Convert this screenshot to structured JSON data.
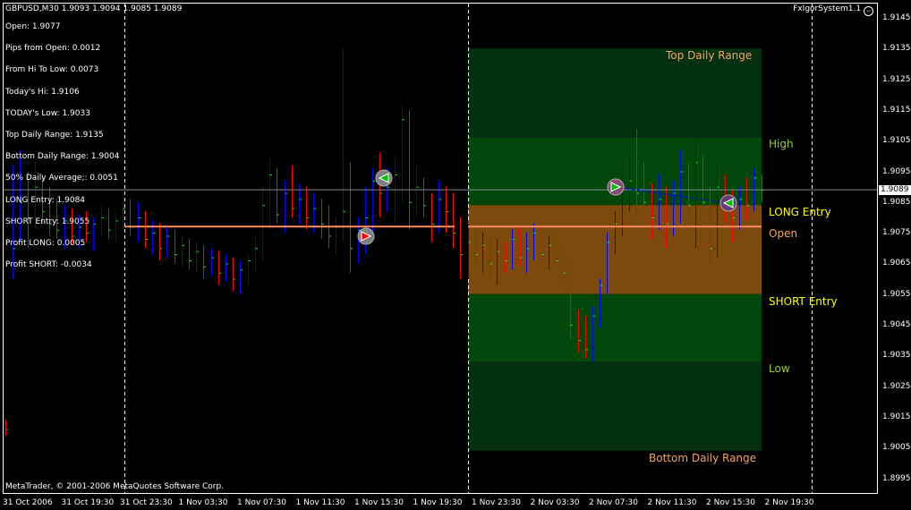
{
  "header": {
    "symbol_line": "GBPUSD,M30  1.9093 1.9094 1.9085 1.9089",
    "indicator_name": "FxIgorSystem1.1",
    "smiley_icon": "smiley-icon"
  },
  "info": [
    "Open: 1.9077",
    "Pips from Open: 0.0012",
    "From Hi To Low: 0.0073",
    "Today's Hi: 1.9106",
    "TODAY's Low: 1.9033",
    "Top Daily Range:  1.9135",
    "Bottom Daily Range: 1.9004",
    "50% Daily Average;: 0.0051",
    "LONG Entry:  1.9084",
    "SHORT Entry: 1.9055",
    "Profit LONG:  0.0005",
    "Profit SHORT: -0.0034"
  ],
  "copyright": "MetaTrader, © 2001-2006 MetaQuotes Software Corp.",
  "current_price": "1.9089",
  "zone_labels": {
    "top": "Top Daily Range",
    "high": "High",
    "long": "LONG Entry",
    "open": "Open",
    "short": "SHORT Entry",
    "low": "Low",
    "bottom": "Bottom Daily Range"
  },
  "colors": {
    "up_bar": "#0000ff",
    "down_bar": "#ff0000",
    "close_tick": "#00ff00",
    "open_line": "#ff8c5a",
    "zone_dark": "#033010",
    "zone_green": "#02480b",
    "zone_orange": "#7d4a0e",
    "label_orange": "#f4a460",
    "label_green": "#9acd32",
    "label_yellow": "#ffff00"
  },
  "chart_data": {
    "type": "ohlc",
    "ylim": [
      1.899,
      1.915
    ],
    "yticks": [
      "1.9145",
      "1.9135",
      "1.9125",
      "1.9115",
      "1.9105",
      "1.9095",
      "1.9085",
      "1.9075",
      "1.9065",
      "1.9055",
      "1.9045",
      "1.9035",
      "1.9025",
      "1.9015",
      "1.9005",
      "1.8995"
    ],
    "xticks": [
      "31 Oct 2006",
      "31 Oct 19:30",
      "31 Oct 23:30",
      "1 Nov 03:30",
      "1 Nov 07:30",
      "1 Nov 11:30",
      "1 Nov 15:30",
      "1 Nov 19:30",
      "1 Nov 23:30",
      "2 Nov 03:30",
      "2 Nov 07:30",
      "2 Nov 11:30",
      "2 Nov 15:30",
      "2 Nov 19:30"
    ],
    "levels": {
      "top": 1.9135,
      "high": 1.9106,
      "long": 1.9084,
      "open": 1.9077,
      "short": 1.9055,
      "low": 1.9033,
      "bottom": 1.9004,
      "bid": 1.9089
    },
    "bars": [
      [
        1.9012,
        1.9014,
        1.9009,
        1.9011
      ],
      [
        1.9011,
        1.9097,
        1.906,
        1.907
      ],
      [
        1.907,
        1.9102,
        1.9072,
        1.9085
      ],
      [
        1.9085,
        1.9095,
        1.907,
        1.908
      ],
      [
        1.908,
        1.9098,
        1.9076,
        1.909
      ],
      [
        1.909,
        1.9094,
        1.9078,
        1.9082
      ],
      [
        1.9082,
        1.909,
        1.9074,
        1.9078
      ],
      [
        1.9078,
        1.9086,
        1.9073,
        1.9076
      ],
      [
        1.9076,
        1.9084,
        1.907,
        1.9079
      ],
      [
        1.9079,
        1.9083,
        1.9071,
        1.9074
      ],
      [
        1.9074,
        1.9081,
        1.907,
        1.9077
      ],
      [
        1.9077,
        1.9082,
        1.9072,
        1.9075
      ],
      [
        1.9075,
        1.908,
        1.9069,
        1.9078
      ],
      [
        1.9078,
        1.9084,
        1.9074,
        1.908
      ],
      [
        1.908,
        1.9083,
        1.9073,
        1.9076
      ],
      [
        1.9076,
        1.9082,
        1.9072,
        1.9079
      ],
      [
        1.9079,
        1.9088,
        1.9076,
        1.9083
      ],
      [
        1.9083,
        1.9086,
        1.9074,
        1.9077
      ],
      [
        1.9077,
        1.9085,
        1.9072,
        1.908
      ],
      [
        1.908,
        1.9082,
        1.907,
        1.9073
      ],
      [
        1.9073,
        1.9079,
        1.9068,
        1.9075
      ],
      [
        1.9075,
        1.9078,
        1.9066,
        1.907
      ],
      [
        1.907,
        1.9077,
        1.9067,
        1.9074
      ],
      [
        1.9074,
        1.9076,
        1.9065,
        1.9068
      ],
      [
        1.9068,
        1.9074,
        1.9064,
        1.9071
      ],
      [
        1.9071,
        1.9073,
        1.9063,
        1.9066
      ],
      [
        1.9066,
        1.9072,
        1.9062,
        1.9069
      ],
      [
        1.9069,
        1.9071,
        1.906,
        1.9064
      ],
      [
        1.9064,
        1.907,
        1.9061,
        1.9067
      ],
      [
        1.9067,
        1.9069,
        1.9058,
        1.9062
      ],
      [
        1.9062,
        1.9068,
        1.9059,
        1.9065
      ],
      [
        1.9065,
        1.9067,
        1.9056,
        1.906
      ],
      [
        1.906,
        1.9066,
        1.9055,
        1.9063
      ],
      [
        1.9063,
        1.9068,
        1.9058,
        1.9066
      ],
      [
        1.9066,
        1.9074,
        1.9062,
        1.907
      ],
      [
        1.907,
        1.909,
        1.9066,
        1.9084
      ],
      [
        1.9084,
        1.9099,
        1.9076,
        1.9094
      ],
      [
        1.9094,
        1.9096,
        1.9078,
        1.9081
      ],
      [
        1.9081,
        1.9092,
        1.9075,
        1.9088
      ],
      [
        1.9088,
        1.9097,
        1.908,
        1.9083
      ],
      [
        1.9083,
        1.9091,
        1.9078,
        1.9086
      ],
      [
        1.9086,
        1.909,
        1.9076,
        1.908
      ],
      [
        1.908,
        1.9088,
        1.9075,
        1.9083
      ],
      [
        1.9083,
        1.9086,
        1.9073,
        1.9078
      ],
      [
        1.9078,
        1.9084,
        1.907,
        1.9074
      ],
      [
        1.9074,
        1.908,
        1.9068,
        1.9077
      ],
      [
        1.9077,
        1.9135,
        1.9072,
        1.9082
      ],
      [
        1.9082,
        1.9098,
        1.9062,
        1.907
      ],
      [
        1.907,
        1.908,
        1.9065,
        1.9076
      ],
      [
        1.9076,
        1.909,
        1.9068,
        1.908
      ],
      [
        1.908,
        1.9096,
        1.9075,
        1.9092
      ],
      [
        1.9092,
        1.9101,
        1.908,
        1.9088
      ],
      [
        1.9088,
        1.9096,
        1.9082,
        1.909
      ],
      [
        1.909,
        1.91,
        1.9078,
        1.9094
      ],
      [
        1.9094,
        1.9117,
        1.9085,
        1.9112
      ],
      [
        1.9112,
        1.9115,
        1.9076,
        1.9085
      ],
      [
        1.9085,
        1.9097,
        1.908,
        1.909
      ],
      [
        1.909,
        1.9093,
        1.908,
        1.9084
      ],
      [
        1.9084,
        1.9088,
        1.9072,
        1.9078
      ],
      [
        1.9078,
        1.9092,
        1.9075,
        1.9086
      ],
      [
        1.9086,
        1.909,
        1.9075,
        1.9082
      ],
      [
        1.9082,
        1.9088,
        1.907,
        1.9075
      ],
      [
        1.9075,
        1.908,
        1.906,
        1.9068
      ],
      [
        1.9068,
        1.9078,
        1.906,
        1.9072
      ],
      [
        1.9072,
        1.9078,
        1.9064,
        1.9068
      ],
      [
        1.9068,
        1.9075,
        1.9062,
        1.9071
      ],
      [
        1.9071,
        1.9074,
        1.906,
        1.9065
      ],
      [
        1.9065,
        1.9073,
        1.9058,
        1.9069
      ],
      [
        1.9069,
        1.9072,
        1.9062,
        1.9066
      ],
      [
        1.9066,
        1.9076,
        1.9063,
        1.9073
      ],
      [
        1.9073,
        1.9077,
        1.9064,
        1.9067
      ],
      [
        1.9067,
        1.9075,
        1.9062,
        1.907
      ],
      [
        1.907,
        1.9078,
        1.9066,
        1.9075
      ],
      [
        1.9075,
        1.9077,
        1.9065,
        1.9068
      ],
      [
        1.9068,
        1.9074,
        1.9063,
        1.9071
      ],
      [
        1.9071,
        1.9076,
        1.9064,
        1.9066
      ],
      [
        1.9066,
        1.907,
        1.9058,
        1.9062
      ],
      [
        1.9062,
        1.9066,
        1.904,
        1.9045
      ],
      [
        1.9045,
        1.905,
        1.9036,
        1.904
      ],
      [
        1.904,
        1.9048,
        1.9034,
        1.9037
      ],
      [
        1.9037,
        1.9051,
        1.9033,
        1.9048
      ],
      [
        1.9048,
        1.906,
        1.9044,
        1.9058
      ],
      [
        1.9058,
        1.9075,
        1.9055,
        1.9072
      ],
      [
        1.9072,
        1.9082,
        1.9068,
        1.9078
      ],
      [
        1.9078,
        1.9094,
        1.9074,
        1.909
      ],
      [
        1.909,
        1.91,
        1.9082,
        1.9092
      ],
      [
        1.9092,
        1.9109,
        1.908,
        1.9088
      ],
      [
        1.9088,
        1.9098,
        1.9082,
        1.9085
      ],
      [
        1.9085,
        1.9091,
        1.9073,
        1.908
      ],
      [
        1.908,
        1.9094,
        1.9076,
        1.9086
      ],
      [
        1.9086,
        1.909,
        1.907,
        1.9078
      ],
      [
        1.9078,
        1.9092,
        1.9074,
        1.9088
      ],
      [
        1.9088,
        1.9102,
        1.9078,
        1.9095
      ],
      [
        1.9095,
        1.9098,
        1.908,
        1.9084
      ],
      [
        1.9084,
        1.9107,
        1.907,
        1.9098
      ],
      [
        1.9098,
        1.91,
        1.9082,
        1.9085
      ],
      [
        1.9085,
        1.909,
        1.9064,
        1.907
      ],
      [
        1.907,
        1.9098,
        1.9067,
        1.909
      ],
      [
        1.909,
        1.9094,
        1.9078,
        1.9084
      ],
      [
        1.9084,
        1.9089,
        1.9072,
        1.908
      ],
      [
        1.908,
        1.909,
        1.9076,
        1.9086
      ],
      [
        1.9086,
        1.9093,
        1.9079,
        1.9084
      ],
      [
        1.9084,
        1.9096,
        1.9082,
        1.9093
      ],
      [
        1.9093,
        1.9094,
        1.9085,
        1.9089
      ]
    ],
    "signals": [
      {
        "type": "sell-arrow",
        "bar": 52,
        "price": 1.9093
      },
      {
        "type": "buy-arrow",
        "bar": 49,
        "price": 1.9074
      },
      {
        "type": "buy-arrow",
        "bar": 83,
        "price": 1.909
      },
      {
        "type": "sell-arrow",
        "bar": 98,
        "price": 1.9084
      }
    ]
  }
}
